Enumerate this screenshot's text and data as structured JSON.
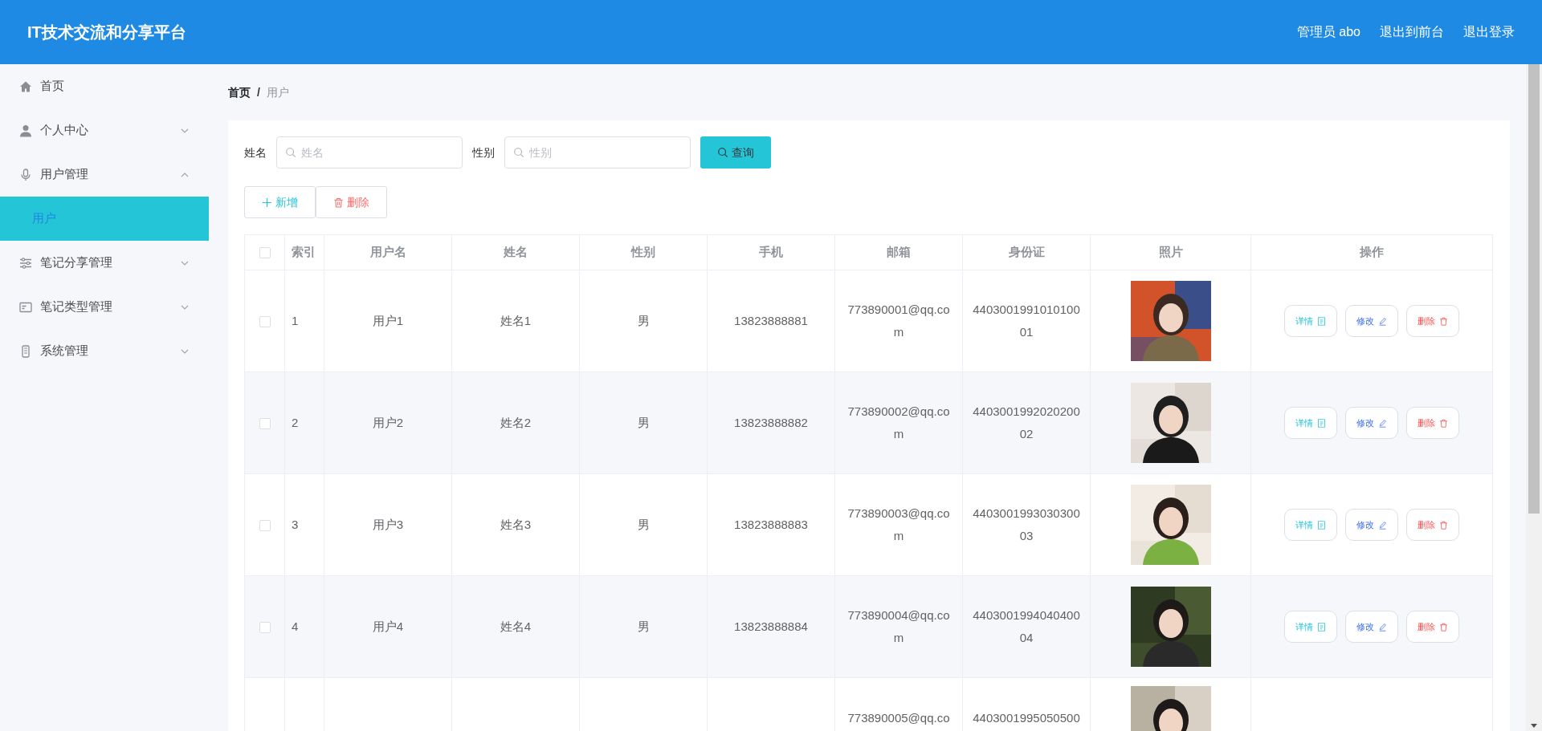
{
  "header": {
    "title": "IT技术交流和分享平台",
    "links": [
      "管理员 abo",
      "退出到前台",
      "退出登录"
    ]
  },
  "sidebar": {
    "items": [
      {
        "label": "首页",
        "selected": false
      },
      {
        "label": "个人中心",
        "selected": false,
        "expanded": false
      },
      {
        "label": "用户管理",
        "selected": false,
        "expanded": true,
        "children": [
          {
            "label": "用户",
            "selected": true
          }
        ]
      },
      {
        "label": "笔记分享管理",
        "selected": false,
        "expanded": false
      },
      {
        "label": "笔记类型管理",
        "selected": false,
        "expanded": false
      },
      {
        "label": "系统管理",
        "selected": false,
        "expanded": false
      }
    ]
  },
  "breadcrumb": {
    "items": [
      "首页",
      "用户"
    ],
    "separator": "/"
  },
  "search": {
    "fields": [
      {
        "label": "姓名",
        "placeholder": "姓名"
      },
      {
        "label": "性别",
        "placeholder": "性别"
      }
    ],
    "button": "查询"
  },
  "toolbar": [
    {
      "kind": "add",
      "label": "新增"
    },
    {
      "kind": "delete",
      "label": "删除"
    }
  ],
  "table": {
    "all_selected": false,
    "columns": [
      "索引",
      "用户名",
      "姓名",
      "性别",
      "手机",
      "邮箱",
      "身份证",
      "照片",
      "操作"
    ],
    "rows": [
      {
        "selected": false,
        "index": "1",
        "username": "用户1",
        "name": "姓名1",
        "gender": "男",
        "phone": "13823888881",
        "email": "773890001@qq.com",
        "id_card": "440300199101010001",
        "actions": [
          "详情",
          "修改",
          "删除"
        ]
      },
      {
        "selected": false,
        "index": "2",
        "username": "用户2",
        "name": "姓名2",
        "gender": "男",
        "phone": "13823888882",
        "email": "773890002@qq.com",
        "id_card": "440300199202020002",
        "actions": [
          "详情",
          "修改",
          "删除"
        ]
      },
      {
        "selected": false,
        "index": "3",
        "username": "用户3",
        "name": "姓名3",
        "gender": "男",
        "phone": "13823888883",
        "email": "773890003@qq.com",
        "id_card": "440300199303030003",
        "actions": [
          "详情",
          "修改",
          "删除"
        ]
      },
      {
        "selected": false,
        "index": "4",
        "username": "用户4",
        "name": "姓名4",
        "gender": "男",
        "phone": "13823888884",
        "email": "773890004@qq.com",
        "id_card": "440300199404040004",
        "actions": [
          "详情",
          "修改",
          "删除"
        ]
      },
      {
        "email": "773890005@qq.co",
        "id_card": "4403001995050500"
      }
    ]
  }
}
